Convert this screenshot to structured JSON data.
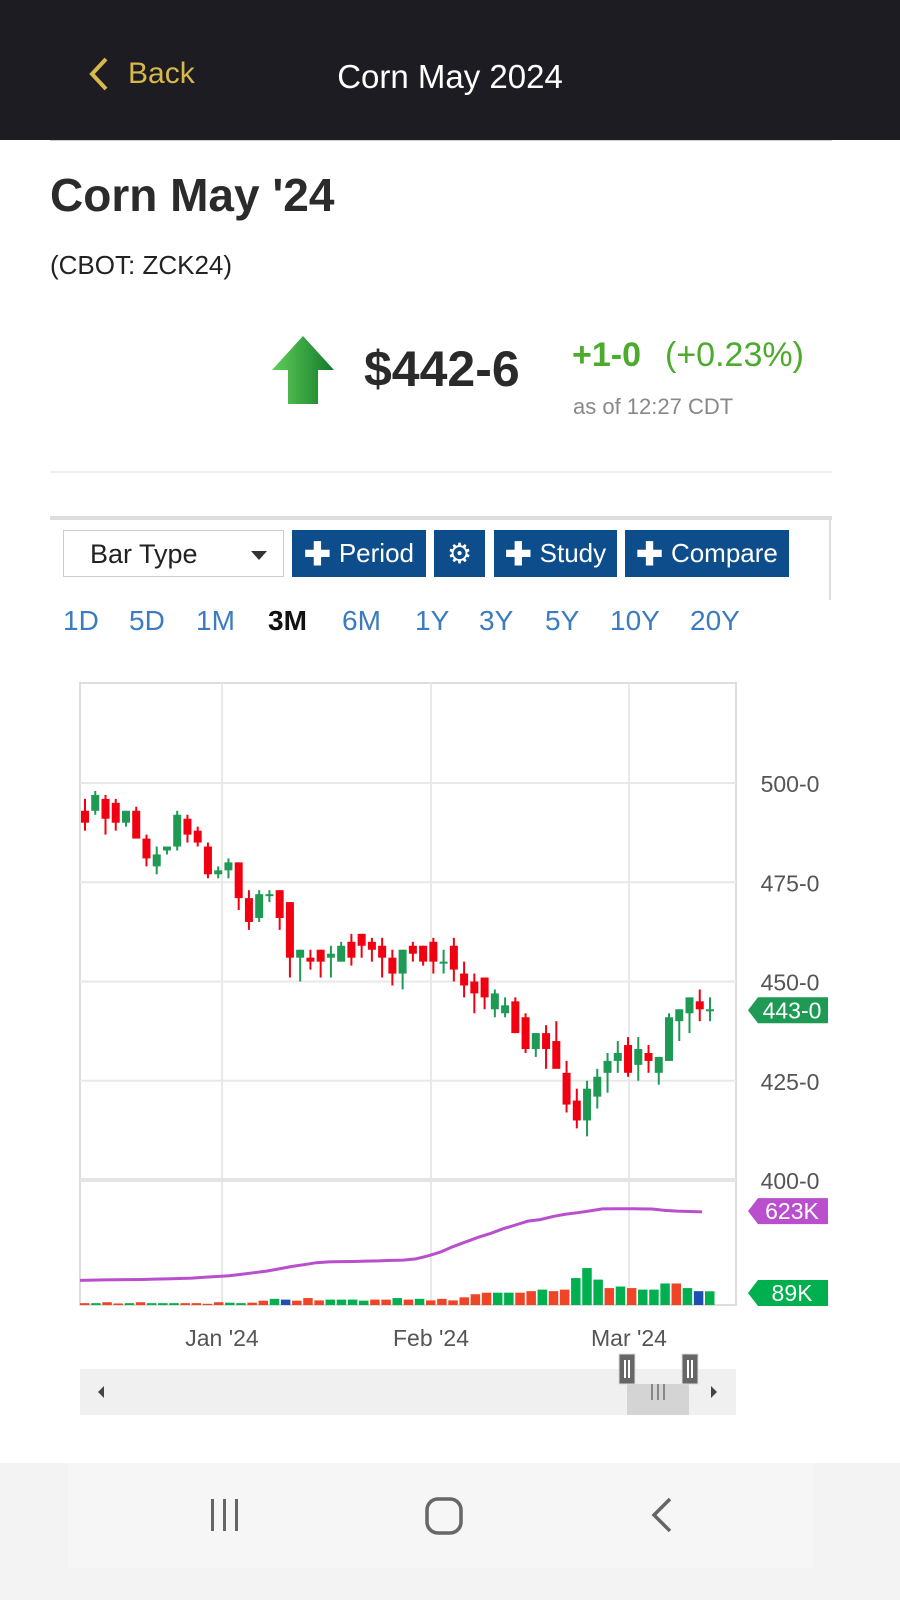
{
  "header": {
    "back_label": "Back",
    "title": "Corn May 2024"
  },
  "instrument": {
    "name": "Corn May '24",
    "symbol": "(CBOT: ZCK24)",
    "price": "$442-6",
    "change": "+1-0",
    "change_pct": "(+0.23%)",
    "as_of": "as of 12:27 CDT",
    "direction": "up",
    "up_color": "#4caa2c"
  },
  "toolbar": {
    "bar_type": "Bar Type",
    "period": "Period",
    "study": "Study",
    "compare": "Compare",
    "settings_icon": "gear-icon"
  },
  "ranges": [
    "1D",
    "5D",
    "1M",
    "3M",
    "6M",
    "1Y",
    "3Y",
    "5Y",
    "10Y",
    "20Y"
  ],
  "active_range": "3M",
  "chart_data": {
    "type": "candlestick",
    "price_axis": {
      "ticks": [
        "500-0",
        "475-0",
        "450-0",
        "425-0",
        "400-0"
      ],
      "tick_values": [
        500,
        475,
        450,
        425,
        400
      ],
      "range": [
        400,
        525
      ]
    },
    "last_price_label": "443-0",
    "last_price": 443,
    "x_labels": [
      "Jan '24",
      "Feb '24",
      "Mar '24"
    ],
    "candles": [
      [
        493,
        496,
        488,
        490
      ],
      [
        493,
        498,
        492,
        497
      ],
      [
        496,
        497,
        487,
        491
      ],
      [
        495,
        496,
        488,
        490
      ],
      [
        490,
        493,
        489,
        493
      ],
      [
        493,
        494,
        487,
        486
      ],
      [
        486,
        487,
        479,
        481
      ],
      [
        479,
        484,
        477,
        482
      ],
      [
        483,
        484,
        482,
        484
      ],
      [
        484,
        493,
        483,
        492
      ],
      [
        491,
        492,
        485,
        487
      ],
      [
        488,
        489,
        484,
        485
      ],
      [
        484,
        485,
        476,
        477
      ],
      [
        477,
        479,
        476,
        478
      ],
      [
        478,
        481,
        476,
        480
      ],
      [
        480,
        480,
        468,
        471
      ],
      [
        471,
        473,
        463,
        465
      ],
      [
        466,
        473,
        465,
        472
      ],
      [
        472,
        473,
        470,
        472
      ],
      [
        473,
        473,
        463,
        466
      ],
      [
        470,
        470,
        451,
        456
      ],
      [
        456,
        458,
        450,
        458
      ],
      [
        456,
        458,
        453,
        455
      ],
      [
        458,
        458,
        451,
        455
      ],
      [
        456,
        459,
        451,
        457
      ],
      [
        455,
        460,
        455,
        459
      ],
      [
        460,
        462,
        454,
        456
      ],
      [
        462,
        462,
        456,
        459
      ],
      [
        460,
        461,
        455,
        458
      ],
      [
        459,
        461,
        451,
        456
      ],
      [
        456,
        458,
        449,
        452
      ],
      [
        452,
        458,
        448,
        458
      ],
      [
        459,
        460,
        455,
        457
      ],
      [
        459,
        459,
        454,
        455
      ],
      [
        460,
        461,
        452,
        455
      ],
      [
        455,
        458,
        452,
        455
      ],
      [
        459,
        461,
        450,
        453
      ],
      [
        452,
        455,
        446,
        449
      ],
      [
        450,
        452,
        442,
        447
      ],
      [
        451,
        451,
        443,
        446
      ],
      [
        443,
        448,
        441,
        447
      ],
      [
        442,
        446,
        441,
        444
      ],
      [
        445,
        446,
        437,
        437
      ],
      [
        441,
        442,
        432,
        433
      ],
      [
        433,
        437,
        431,
        437
      ],
      [
        437,
        439,
        428,
        433
      ],
      [
        435,
        440,
        430,
        428
      ],
      [
        427,
        430,
        417,
        419
      ],
      [
        420,
        423,
        413,
        415
      ],
      [
        415,
        425,
        411,
        423
      ],
      [
        421,
        428,
        418,
        426
      ],
      [
        427,
        432,
        422,
        430
      ],
      [
        430,
        435,
        427,
        432
      ],
      [
        434,
        436,
        426,
        427
      ],
      [
        429,
        436,
        425,
        433
      ],
      [
        432,
        434,
        427,
        430
      ],
      [
        427,
        431,
        424,
        431
      ],
      [
        430,
        442,
        430,
        441
      ],
      [
        440,
        443,
        435,
        443
      ],
      [
        442,
        446,
        437,
        446
      ],
      [
        445,
        448,
        440,
        443
      ],
      [
        443,
        446,
        440,
        443
      ]
    ],
    "volume": {
      "label": "89K",
      "last": 89,
      "color": "#00b04f",
      "values": [
        12,
        12,
        18,
        10,
        12,
        18,
        12,
        12,
        12,
        12,
        12,
        8,
        18,
        15,
        12,
        15,
        28,
        40,
        35,
        28,
        45,
        30,
        35,
        35,
        35,
        28,
        35,
        35,
        45,
        35,
        40,
        30,
        40,
        30,
        50,
        70,
        80,
        80,
        80,
        80,
        90,
        100,
        90,
        100,
        175,
        240,
        165,
        110,
        120,
        110,
        100,
        100,
        140,
        140,
        110,
        90,
        89
      ],
      "colors": [
        "r",
        "g",
        "r",
        "r",
        "g",
        "r",
        "g",
        "g",
        "g",
        "r",
        "r",
        "r",
        "r",
        "g",
        "g",
        "r",
        "r",
        "g",
        "b",
        "r",
        "r",
        "r",
        "g",
        "g",
        "g",
        "g",
        "r",
        "r",
        "g",
        "r",
        "g",
        "r",
        "r",
        "r",
        "r",
        "r",
        "r",
        "g",
        "g",
        "r",
        "r",
        "g",
        "r",
        "r",
        "g",
        "g",
        "g",
        "r",
        "g",
        "r",
        "g",
        "g",
        "g",
        "r",
        "g",
        "b",
        "g"
      ]
    },
    "open_interest": {
      "label": "623K",
      "last": 623,
      "color": "#b94fcc",
      "values": [
        160,
        162,
        163,
        164,
        165,
        166,
        168,
        170,
        172,
        175,
        180,
        185,
        190,
        200,
        210,
        220,
        235,
        250,
        262,
        275,
        280,
        282,
        283,
        285,
        287,
        290,
        292,
        300,
        320,
        345,
        380,
        410,
        440,
        465,
        495,
        520,
        545,
        555,
        575,
        590,
        600,
        612,
        625,
        626,
        626,
        625,
        624,
        615,
        610,
        608,
        605
      ]
    },
    "scroller": {
      "left_icon": "chevron-left-icon",
      "right_icon": "chevron-right-icon"
    }
  },
  "system_nav": {
    "recents": "recents-icon",
    "home": "home-icon",
    "back": "back-icon"
  }
}
